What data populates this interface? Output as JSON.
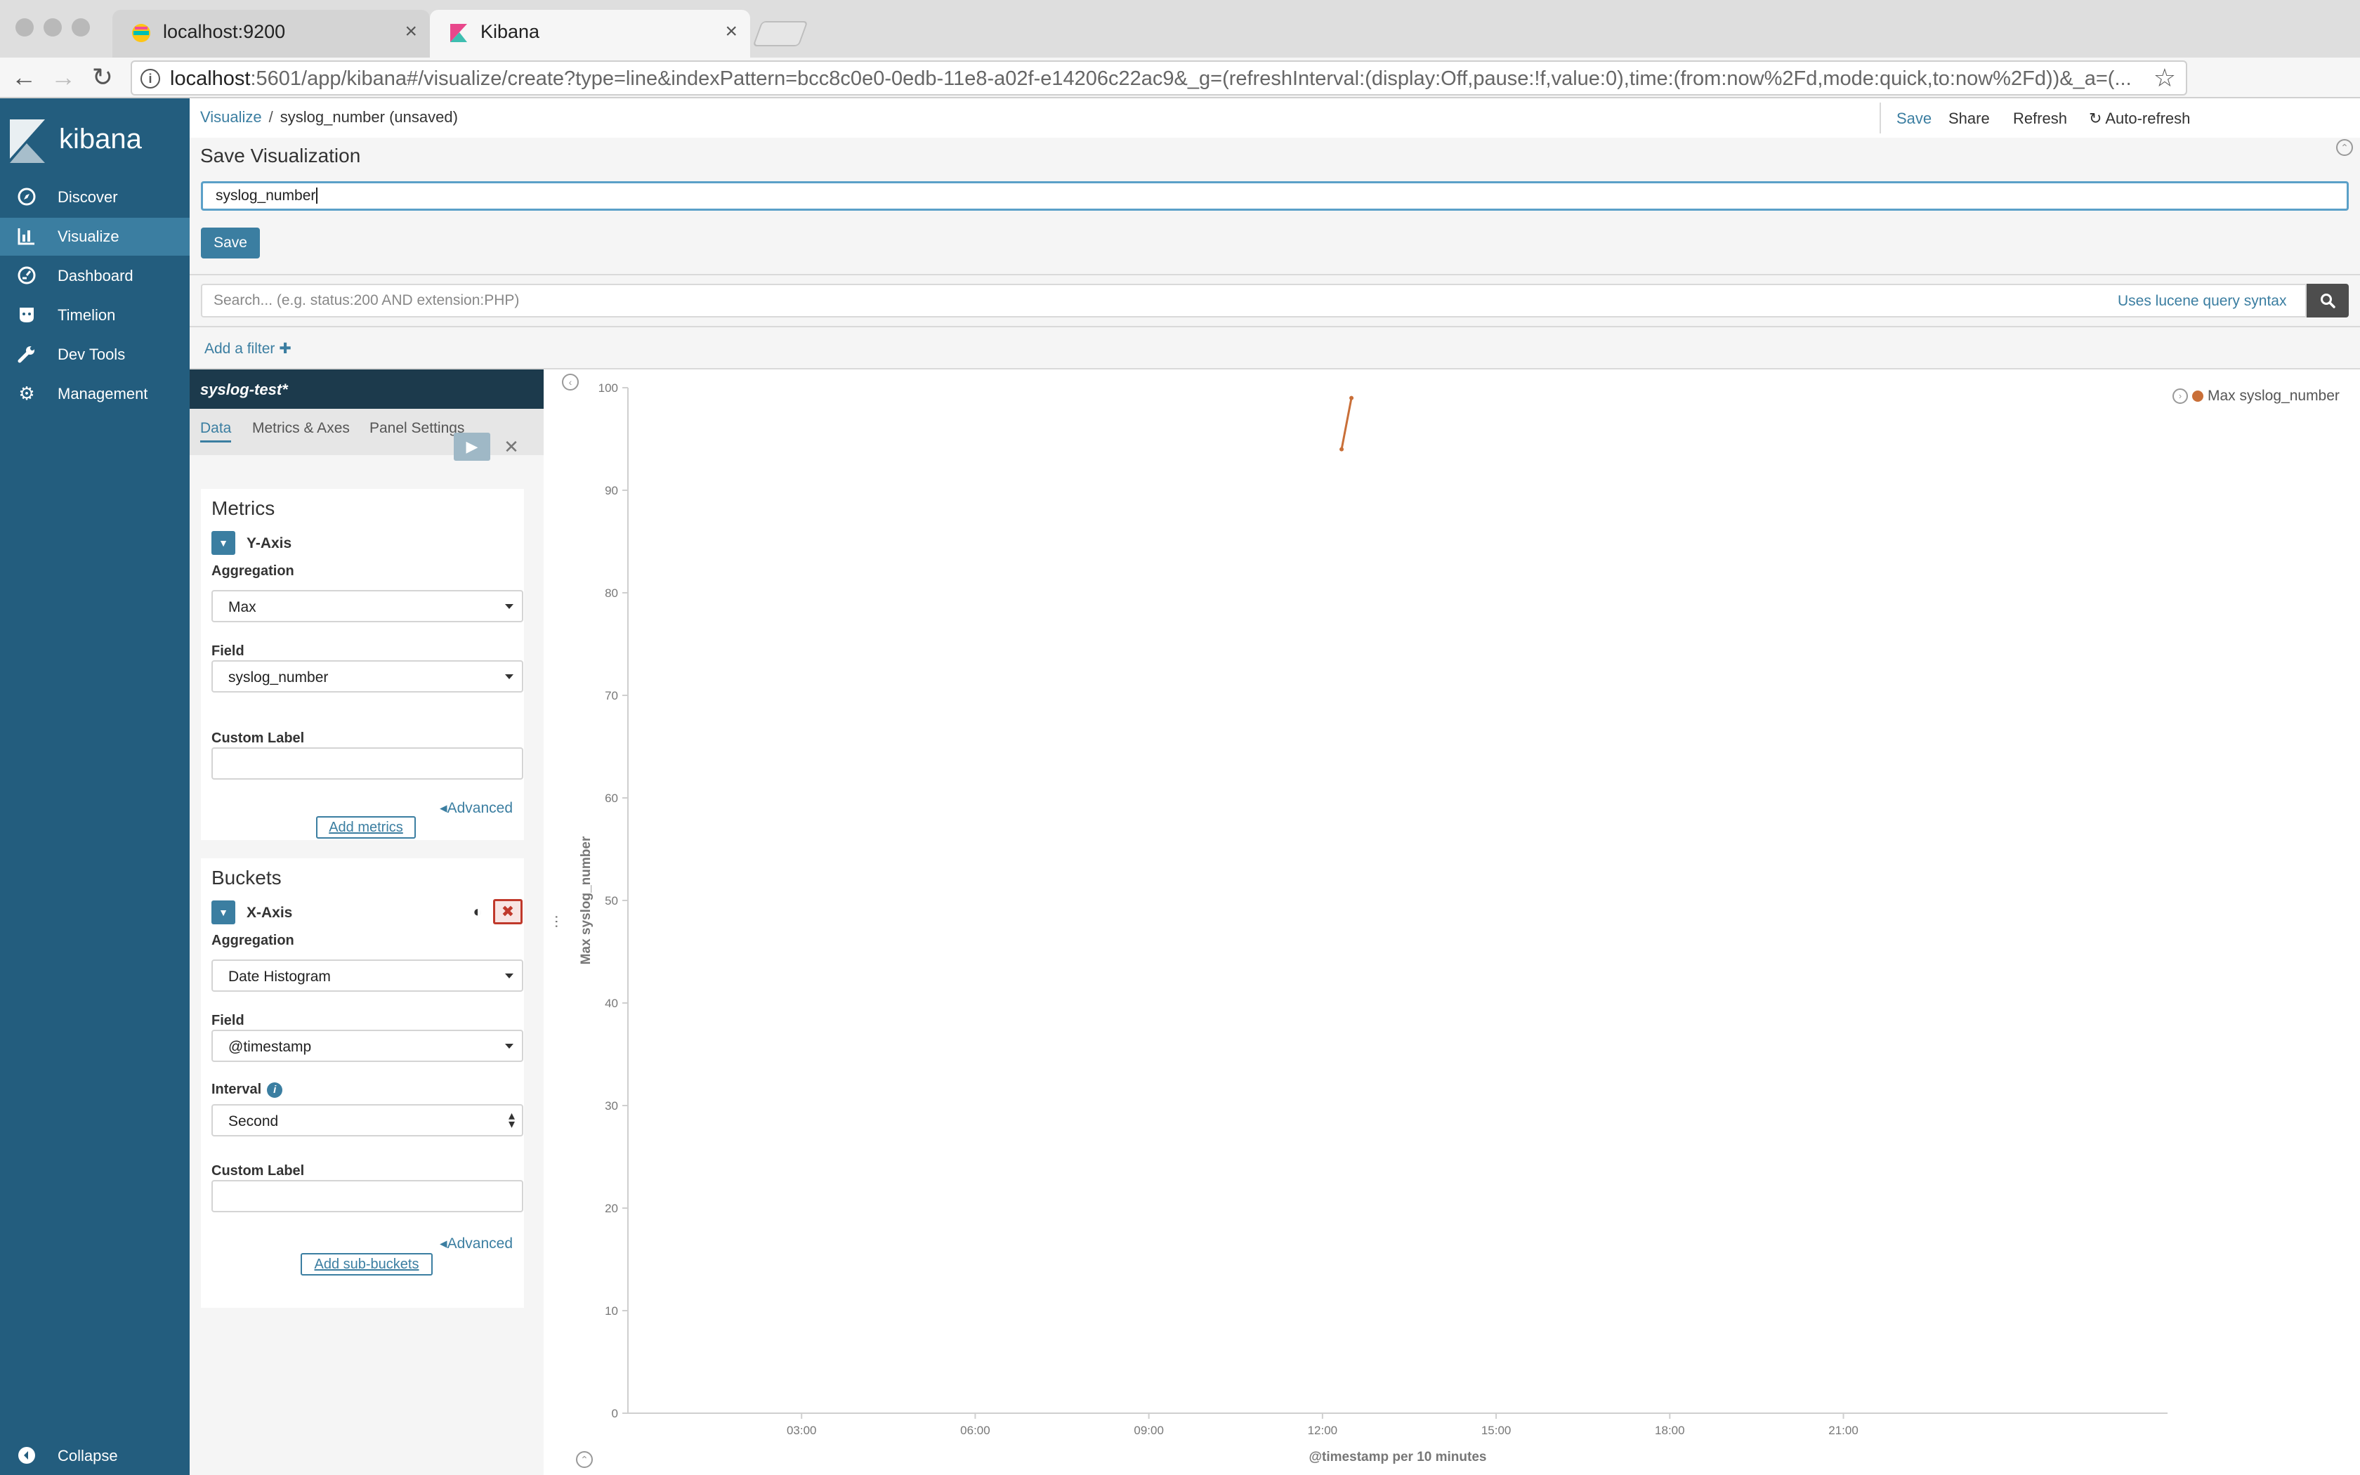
{
  "browser": {
    "tabs": [
      {
        "title": "localhost:9200",
        "favicon": "elastic-favicon-icon"
      },
      {
        "title": "Kibana",
        "favicon": "kibana-favicon-icon"
      }
    ],
    "url_host": "localhost",
    "url_rest": ":5601/app/kibana#/visualize/create?type=line&indexPattern=bcc8c0e0-0edb-11e8-a02f-e14206c22ac9&_g=(refreshInterval:(display:Off,pause:!f,value:0),time:(from:now%2Fd,mode:quick,to:now%2Fd))&_a=(..."
  },
  "sidebar": {
    "brand": "kibana",
    "items": [
      {
        "label": "Discover",
        "icon": "compass-icon"
      },
      {
        "label": "Visualize",
        "icon": "bar-chart-icon"
      },
      {
        "label": "Dashboard",
        "icon": "dashboard-icon"
      },
      {
        "label": "Timelion",
        "icon": "timelion-icon"
      },
      {
        "label": "Dev Tools",
        "icon": "wrench-icon"
      },
      {
        "label": "Management",
        "icon": "gear-icon"
      }
    ],
    "collapse_label": "Collapse"
  },
  "breadcrumb": {
    "root": "Visualize",
    "separator": "/",
    "current": "syslog_number (unsaved)"
  },
  "topnav": {
    "save": "Save",
    "share": "Share",
    "refresh": "Refresh",
    "auto_refresh": "Auto-refresh"
  },
  "save_panel": {
    "title": "Save Visualization",
    "input_value": "syslog_number",
    "save_button": "Save"
  },
  "query": {
    "placeholder": "Search... (e.g. status:200 AND extension:PHP)",
    "syntax_link": "Uses lucene query syntax"
  },
  "filter": {
    "add_label": "Add a filter",
    "plus": "✚"
  },
  "editor": {
    "index_pattern": "syslog-test*",
    "tabs": [
      "Data",
      "Metrics & Axes",
      "Panel Settings"
    ],
    "metrics": {
      "title": "Metrics",
      "agg_title": "Y-Axis",
      "aggregation_label": "Aggregation",
      "aggregation_value": "Max",
      "field_label": "Field",
      "field_value": "syslog_number",
      "custom_label": "Custom Label",
      "advanced": "Advanced",
      "add_button": "Add metrics"
    },
    "buckets": {
      "title": "Buckets",
      "agg_title": "X-Axis",
      "aggregation_label": "Aggregation",
      "aggregation_value": "Date Histogram",
      "field_label": "Field",
      "field_value": "@timestamp",
      "interval_label": "Interval",
      "interval_value": "Second",
      "custom_label": "Custom Label",
      "advanced": "Advanced",
      "add_button": "Add sub-buckets"
    }
  },
  "chart_data": {
    "type": "line",
    "xlabel": "@timestamp per 10 minutes",
    "ylabel": "Max syslog_number",
    "ylim": [
      0,
      100
    ],
    "y_ticks": [
      0,
      10,
      20,
      30,
      40,
      50,
      60,
      70,
      80,
      90,
      100
    ],
    "xlim_hours": [
      0,
      26.6
    ],
    "x_ticks": [
      {
        "label": "03:00",
        "hour": 3
      },
      {
        "label": "06:00",
        "hour": 6
      },
      {
        "label": "09:00",
        "hour": 9
      },
      {
        "label": "12:00",
        "hour": 12
      },
      {
        "label": "15:00",
        "hour": 15
      },
      {
        "label": "18:00",
        "hour": 18
      },
      {
        "label": "21:00",
        "hour": 21
      }
    ],
    "series": [
      {
        "name": "Max syslog_number",
        "color": "#c96f38",
        "points": [
          {
            "hour": 12.33,
            "y": 94
          },
          {
            "hour": 12.5,
            "y": 99
          }
        ]
      }
    ],
    "legend_position": "top-right"
  },
  "colors": {
    "sidebar": "#235d7e",
    "sidebar_active": "#3b7ea1",
    "accent": "#3b7ea1",
    "series": "#c96f38"
  }
}
